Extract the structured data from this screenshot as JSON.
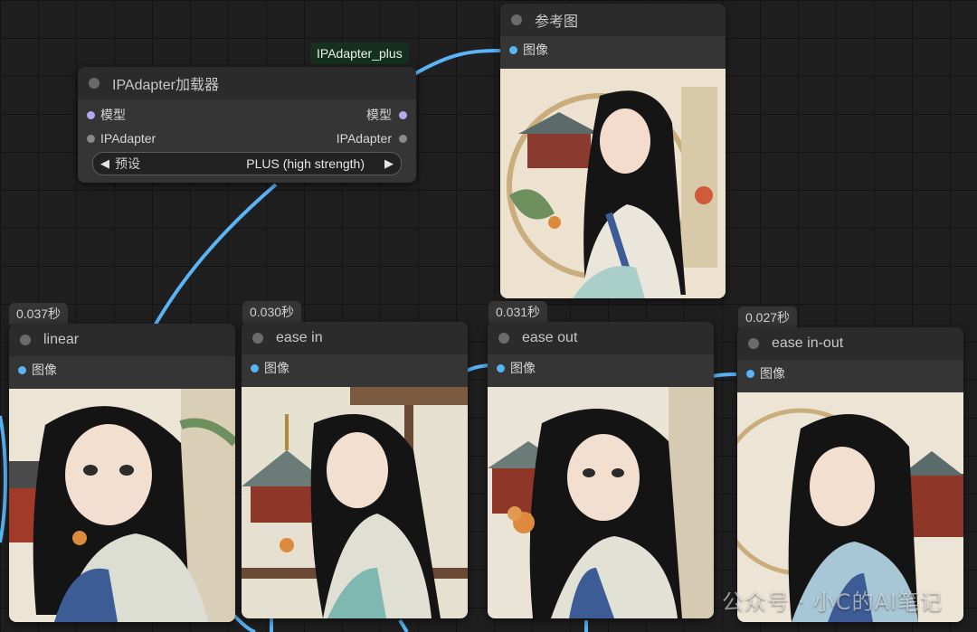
{
  "loader": {
    "title": "IPAdapter加载器",
    "inputs": [
      "模型",
      "IPAdapter"
    ],
    "outputs": [
      "模型",
      "IPAdapter"
    ],
    "preset_name": "预设",
    "preset_value": "PLUS (high strength)",
    "output_label": "IPAdapter_plus"
  },
  "reference": {
    "title": "参考图",
    "slot": "图像"
  },
  "preview_nodes": [
    {
      "title": "linear",
      "time": "0.037秒",
      "slot": "图像"
    },
    {
      "title": "ease in",
      "time": "0.030秒",
      "slot": "图像"
    },
    {
      "title": "ease out",
      "time": "0.031秒",
      "slot": "图像"
    },
    {
      "title": "ease in-out",
      "time": "0.027秒",
      "slot": "图像"
    }
  ],
  "watermark": "公众号 · 小C的AI笔记",
  "colors": {
    "wire": "#5ab4f5",
    "canvas": "#1f1f1f",
    "node": "#353535",
    "header": "#2b2b2b"
  }
}
